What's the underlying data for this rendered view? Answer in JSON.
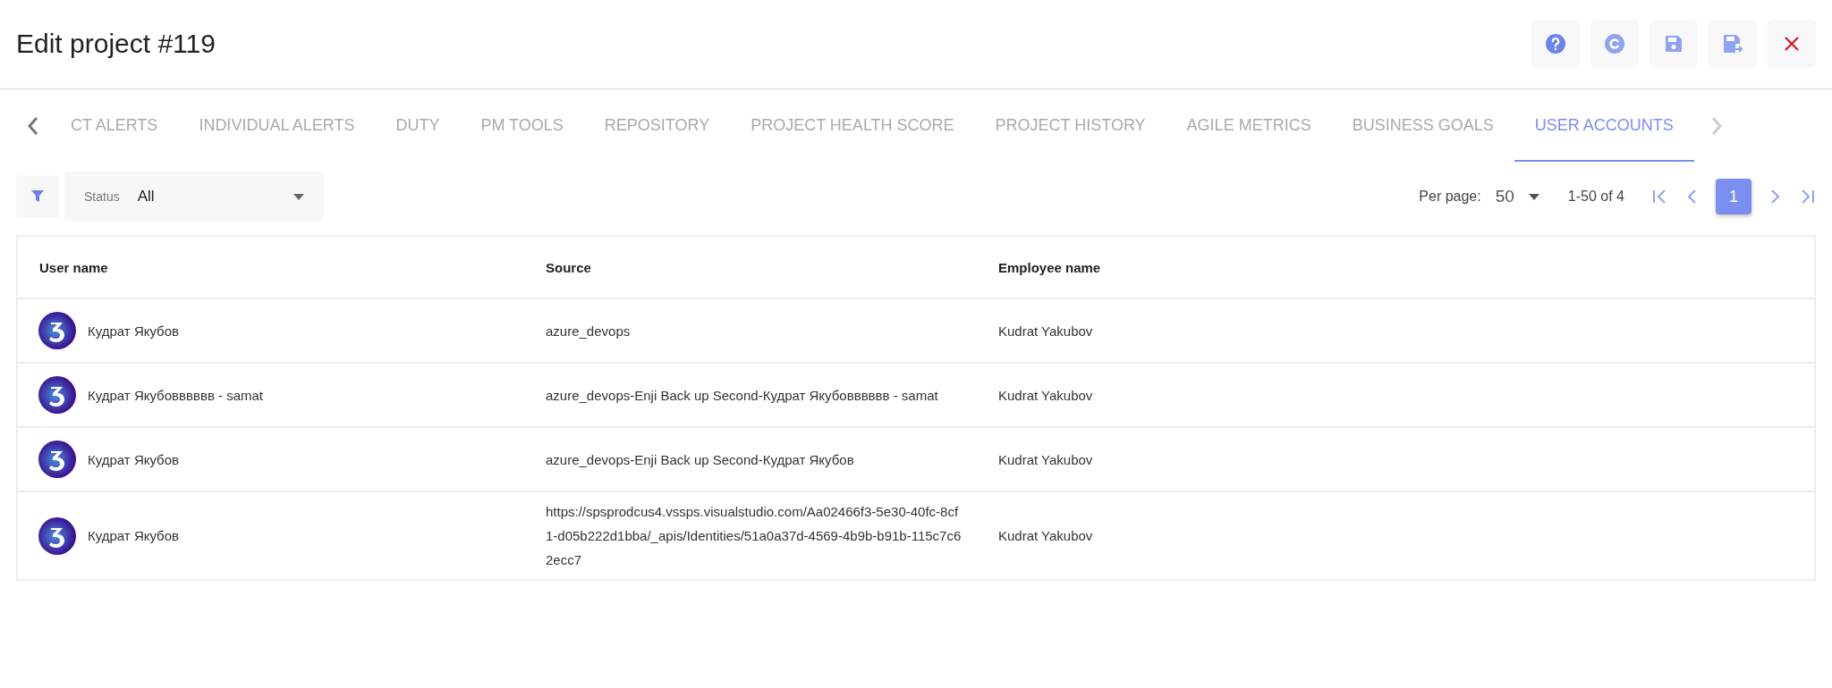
{
  "title": "Edit project #119",
  "tabs": [
    {
      "label": "CT ALERTS",
      "selected": false
    },
    {
      "label": "INDIVIDUAL ALERTS",
      "selected": false
    },
    {
      "label": "DUTY",
      "selected": false
    },
    {
      "label": "PM TOOLS",
      "selected": false
    },
    {
      "label": "REPOSITORY",
      "selected": false
    },
    {
      "label": "PROJECT HEALTH SCORE",
      "selected": false
    },
    {
      "label": "PROJECT HISTORY",
      "selected": false
    },
    {
      "label": "AGILE METRICS",
      "selected": false
    },
    {
      "label": "BUSINESS GOALS",
      "selected": false
    },
    {
      "label": "USER ACCOUNTS",
      "selected": true
    }
  ],
  "filter": {
    "label": "Status",
    "value": "All"
  },
  "pagination": {
    "per_page_label": "Per page:",
    "per_page": "50",
    "range": "1-50 of 4",
    "pages": [
      {
        "label": "1",
        "selected": true
      }
    ]
  },
  "table": {
    "columns": [
      "User name",
      "Source",
      "Employee name"
    ],
    "rows": [
      {
        "user_name": "Кудрат Якубов",
        "source": "azure_devops",
        "employee_name": "Kudrat Yakubov"
      },
      {
        "user_name": "Кудрат Якубовввввв - samat",
        "source": "azure_devops-Enji Back up Second-Кудрат Якубовввввв - samat",
        "employee_name": "Kudrat Yakubov"
      },
      {
        "user_name": "Кудрат Якубов",
        "source": "azure_devops-Enji Back up Second-Кудрат Якубов",
        "employee_name": "Kudrat Yakubov"
      },
      {
        "user_name": "Кудрат Якубов",
        "source": "https://spsprodcus4.vssps.visualstudio.com/Aa02466f3-5e30-40fc-8cf1-d05b222d1bba/_apis/Identities/51a0a37d-4569-4b9b-b91b-115c7c62ecc7",
        "employee_name": "Kudrat Yakubov"
      }
    ]
  }
}
